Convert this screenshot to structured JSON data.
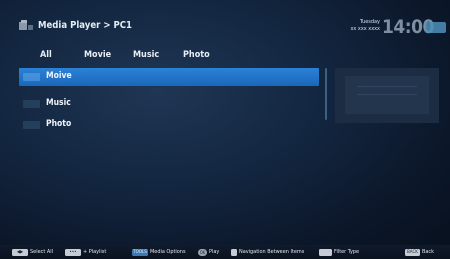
{
  "header": {
    "breadcrumb": "Media Player > PC1",
    "day": "Tuesday",
    "date": "xx xxx xxxx",
    "time": "14:00"
  },
  "tabs": [
    {
      "label": "All",
      "selected": true
    },
    {
      "label": "Movie",
      "selected": false
    },
    {
      "label": "Music",
      "selected": false
    },
    {
      "label": "Photo",
      "selected": false
    }
  ],
  "list": [
    {
      "label": "Moive",
      "selected": true
    },
    {
      "label": "Music",
      "selected": false
    },
    {
      "label": "Photo",
      "selected": false
    }
  ],
  "footer": [
    {
      "key": "◀▶",
      "label": "Select All"
    },
    {
      "key": "•••",
      "label": "+ Playlist"
    },
    {
      "key": "TOOLS",
      "label": "Media Options"
    },
    {
      "key": "OK",
      "label": "Play"
    },
    {
      "key": "",
      "label": "Navigation Between Items"
    },
    {
      "key": "",
      "label": "Filter Type"
    },
    {
      "key": "BACK",
      "label": "Back"
    }
  ],
  "colors": {
    "accent": "#2b82d6",
    "background": "#132640"
  }
}
